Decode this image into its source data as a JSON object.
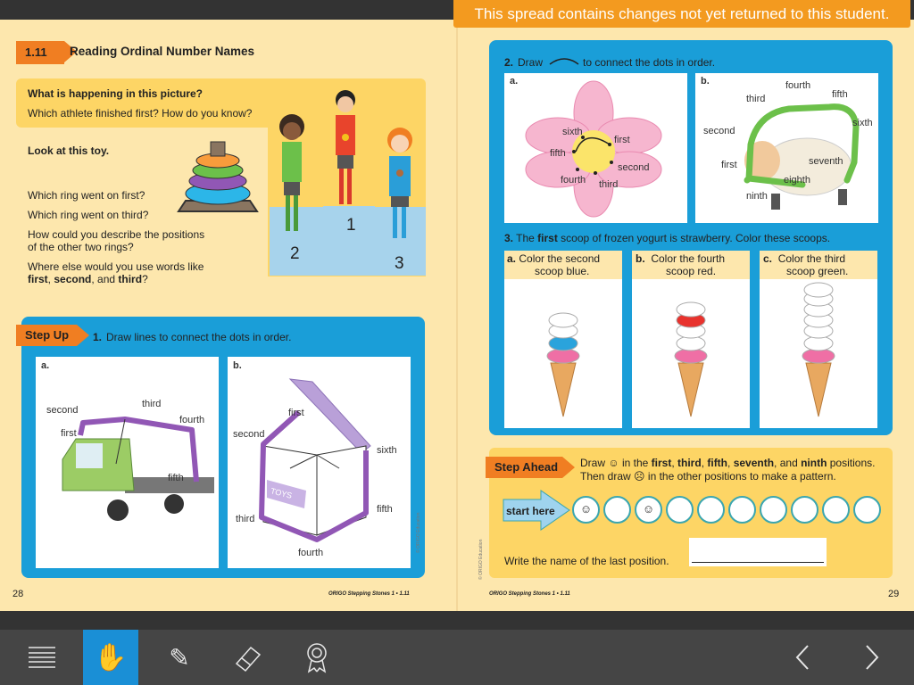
{
  "banner": "This spread contains changes not yet returned to this student.",
  "left": {
    "lesson_number": "1.11",
    "lesson_title": "Reading Ordinal Number Names",
    "q_header": "What is happening in this picture?",
    "q_sub": "Which athlete finished first? How do you know?",
    "toy_prompt": "Look at this toy.",
    "ring_first": "Which ring went on first?",
    "ring_third": "Which ring went on third?",
    "describe_1": "How could you describe the positions",
    "describe_2": "of the other two rings?",
    "where_1": "Where else would you use words like",
    "where_first": "first",
    "where_second": "second",
    "where_and": ", and ",
    "where_third": "third",
    "where_end": "?",
    "podium": [
      "1",
      "2",
      "3"
    ],
    "step_up": "Step Up",
    "q1_num": "1.",
    "q1_text": "Draw lines to connect the dots in order.",
    "a": "a.",
    "b": "b.",
    "truck_labels": [
      "first",
      "second",
      "third",
      "fourth",
      "fifth"
    ],
    "box_labels": [
      "first",
      "second",
      "third",
      "fourth",
      "fifth",
      "sixth"
    ],
    "box_toys": "TOYS",
    "page_number": "28",
    "footer": "ORIGO Stepping Stones  1 • 1.11",
    "copyright": "© ORIGO Education"
  },
  "right": {
    "q2_num": "2.",
    "q2_draw": "Draw",
    "q2_rest": "to connect the dots in order.",
    "a": "a.",
    "b": "b.",
    "flower_labels": [
      "first",
      "second",
      "third",
      "fourth",
      "fifth",
      "sixth"
    ],
    "sheep_labels": [
      "first",
      "second",
      "third",
      "fourth",
      "fifth",
      "sixth",
      "seventh",
      "eighth",
      "ninth"
    ],
    "q3_num": "3.",
    "q3_pre": "The ",
    "q3_bold": "first",
    "q3_rest": " scoop of frozen yogurt is strawberry. Color these scoops.",
    "cones": [
      {
        "letter": "a.",
        "line1": "Color the second",
        "line2": "scoop blue.",
        "color": "#2aa3dc"
      },
      {
        "letter": "b.",
        "line1": "Color the fourth",
        "line2": "scoop red.",
        "color": "#e8322d"
      },
      {
        "letter": "c.",
        "line1": "Color the third",
        "line2": "scoop green.",
        "color": null
      }
    ],
    "step_ahead": "Step Ahead",
    "sa_line1_a": "Draw",
    "sa_line1_b": "in the",
    "sa_bold": [
      "first",
      "third",
      "fifth",
      "seventh",
      "ninth"
    ],
    "sa_line1_end": "positions.",
    "sa_line2_a": "Then draw",
    "sa_line2_b": "in the other positions to make a pattern.",
    "start_here": "start here",
    "faces": [
      "☺",
      "",
      "☺",
      "",
      "",
      "",
      "",
      "",
      "",
      ""
    ],
    "last_position_prompt": "Write the name of the last position.",
    "last_position_value": "",
    "page_number": "29",
    "footer": "ORIGO Stepping Stones  1 • 1.11",
    "copyright": "© ORIGO Education"
  },
  "toolbar": {
    "active_tool": "hand",
    "accent": "#1a8fd6"
  }
}
